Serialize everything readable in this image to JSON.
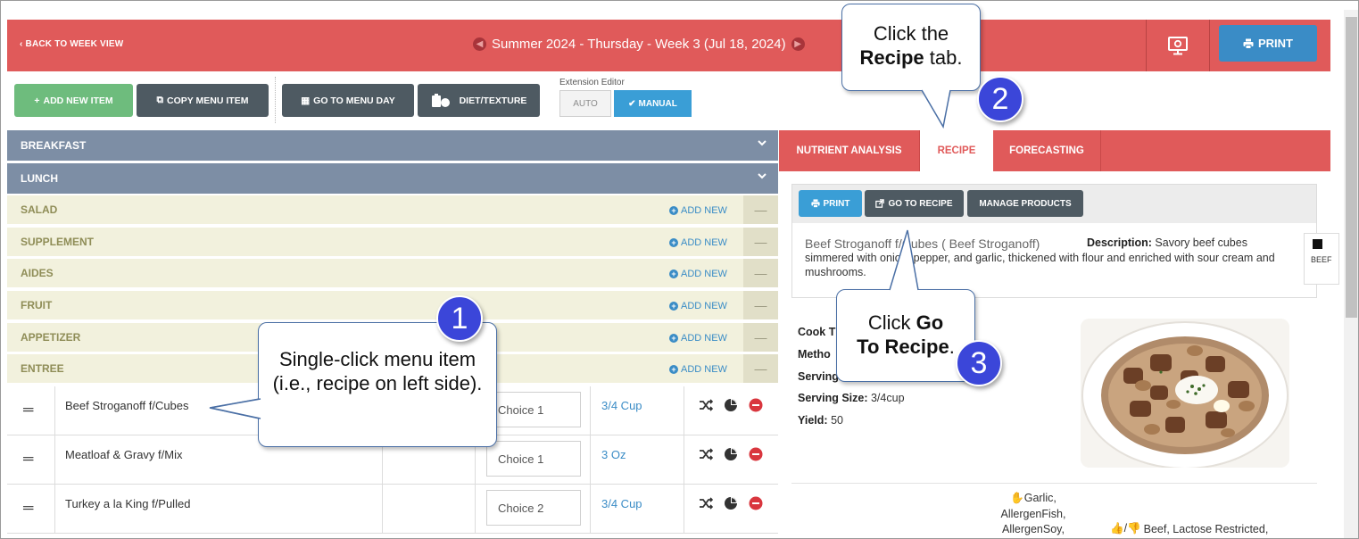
{
  "header": {
    "back_label": "BACK TO WEEK VIEW",
    "title": "Summer 2024 - Thursday - Week 3 (Jul 18, 2024)",
    "print_label": "PRINT"
  },
  "toolbar": {
    "add_new_item": "ADD NEW ITEM",
    "copy_menu_item": "COPY MENU ITEM",
    "go_to_menu_day": "GO TO MENU DAY",
    "diet_texture": "DIET/TEXTURE",
    "extension_editor_label": "Extension Editor",
    "auto_label": "AUTO",
    "manual_label": "MANUAL"
  },
  "meals": {
    "breakfast": "BREAKFAST",
    "lunch": "LUNCH",
    "add_new_label": "ADD NEW",
    "minus_symbol": "—",
    "categories": [
      "SALAD",
      "SUPPLEMENT",
      "AIDES",
      "FRUIT",
      "APPETIZER",
      "ENTREE"
    ]
  },
  "items": [
    {
      "name": "Beef Stroganoff f/Cubes",
      "choice": "Choice 1",
      "portion": "3/4 Cup"
    },
    {
      "name": "Meatloaf & Gravy f/Mix",
      "choice": "Choice 1",
      "portion": "3 Oz"
    },
    {
      "name": "Turkey a la King f/Pulled",
      "choice": "Choice 2",
      "portion": "3/4 Cup"
    }
  ],
  "right_panel": {
    "tabs": [
      "NUTRIENT ANALYSIS",
      "RECIPE",
      "FORECASTING"
    ],
    "active_tab": "RECIPE",
    "print_label": "PRINT",
    "go_to_recipe_label": "GO TO RECIPE",
    "manage_products_label": "MANAGE PRODUCTS",
    "recipe_title": "Beef Stroganoff f/Cubes ( Beef Stroganoff)",
    "description_label": "Description:",
    "description_text": "Savory beef cubes simmered with onion, pepper, and garlic, thickened with flour and enriched with sour cream and mushrooms.",
    "badge_label": "BEEF",
    "props": [
      {
        "label": "Cook T",
        "value": ""
      },
      {
        "label": "Metho",
        "value": ""
      },
      {
        "label": "Serving",
        "value": ""
      },
      {
        "label": "Serving Size:",
        "value": "3/4cup"
      },
      {
        "label": "Yield:",
        "value": "50"
      }
    ],
    "allergens": [
      "Garlic,",
      "AllergenFish,",
      "AllergenSoy,"
    ],
    "diet_text": "Beef, Lactose Restricted,"
  },
  "callouts": {
    "c1_text": "Single-click menu item (i.e., recipe on left side).",
    "c1_num": "1",
    "c2_line1": "Click the",
    "c2_bold": "Recipe",
    "c2_rest": "tab.",
    "c2_num": "2",
    "c3_pre": "Click",
    "c3_bold1": "Go",
    "c3_bold2": "To Recipe",
    "c3_post": ".",
    "c3_num": "3"
  },
  "colors": {
    "brand_red": "#e05a5a",
    "section_blue_gray": "#7d8ea5",
    "button_dark": "#4e5a62",
    "button_green": "#6ebc7d",
    "button_blue": "#3a9ed6",
    "callout_badge": "#3b46d9"
  },
  "icons": [
    "chevron-left-icon",
    "settings-monitor-icon",
    "printer-icon",
    "shuffle-icon",
    "pie-chart-icon",
    "remove-icon",
    "drag-handle-icon",
    "external-link-icon",
    "hand-stop-icon",
    "thumbs-icon"
  ]
}
